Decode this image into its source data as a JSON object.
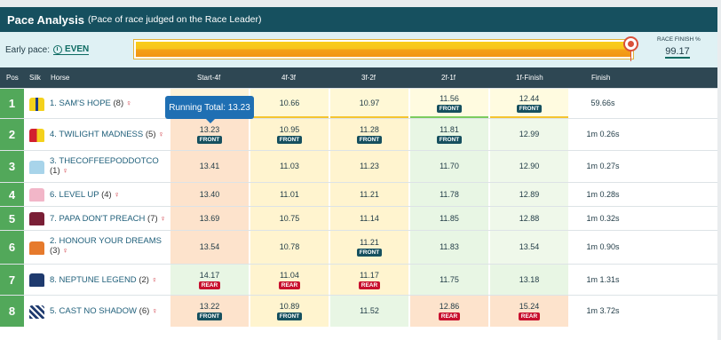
{
  "header": {
    "title": "Pace Analysis",
    "subtitle": "(Pace of race judged on the Race Leader)"
  },
  "pace": {
    "label": "Early pace:",
    "value": "EVEN",
    "finish_label": "RACE FINISH %",
    "finish_value": "99.17",
    "progress": 0.99
  },
  "columns": {
    "pos": "Pos",
    "silk": "Silk",
    "horse": "Horse",
    "c1": "Start-4f",
    "c2": "4f-3f",
    "c3": "3f-2f",
    "c4": "2f-1f",
    "c5": "1f-Finish",
    "finish": "Finish"
  },
  "tooltip": "Running Total: 13.23",
  "colors": {
    "accent": "#16505f",
    "position": "#52a85a",
    "front_badge": "#16505f",
    "rear_badge": "#c8102e",
    "pin": "#cc2b36"
  },
  "rows": [
    {
      "pos": "1",
      "horse": "1. SAM'S HOPE",
      "draw": "(8)",
      "silk": "silk-yellow-blue",
      "cells": [
        {
          "v": ""
        },
        {
          "v": "10.66"
        },
        {
          "v": "10.97"
        },
        {
          "v": "11.56",
          "b": "FRONT"
        },
        {
          "v": "12.44",
          "b": "FRONT"
        }
      ],
      "finish": "59.66s"
    },
    {
      "pos": "2",
      "horse": "4. TWILIGHT MADNESS",
      "draw": "(5)",
      "silk": "silk-red-yellow",
      "cells": [
        {
          "v": "13.23",
          "b": "FRONT"
        },
        {
          "v": "10.95",
          "b": "FRONT"
        },
        {
          "v": "11.28",
          "b": "FRONT"
        },
        {
          "v": "11.81",
          "b": "FRONT"
        },
        {
          "v": "12.99"
        }
      ],
      "finish": "1m 0.26s"
    },
    {
      "pos": "3",
      "horse": "3. THECOFFEEPODDOTCO",
      "draw": "(1)",
      "silk": "silk-lightblue",
      "cells": [
        {
          "v": "13.41"
        },
        {
          "v": "11.03"
        },
        {
          "v": "11.23"
        },
        {
          "v": "11.70"
        },
        {
          "v": "12.90"
        }
      ],
      "finish": "1m 0.27s"
    },
    {
      "pos": "4",
      "horse": "6. LEVEL UP",
      "draw": "(4)",
      "silk": "silk-pink",
      "cells": [
        {
          "v": "13.40"
        },
        {
          "v": "11.01"
        },
        {
          "v": "11.21"
        },
        {
          "v": "11.78"
        },
        {
          "v": "12.89"
        }
      ],
      "finish": "1m 0.28s"
    },
    {
      "pos": "5",
      "horse": "7. PAPA DON'T PREACH",
      "draw": "(7)",
      "silk": "silk-maroon",
      "cells": [
        {
          "v": "13.69"
        },
        {
          "v": "10.75"
        },
        {
          "v": "11.14"
        },
        {
          "v": "11.85"
        },
        {
          "v": "12.88"
        }
      ],
      "finish": "1m 0.32s"
    },
    {
      "pos": "6",
      "horse": "2. HONOUR YOUR DREAMS",
      "draw": "(3)",
      "silk": "silk-orange",
      "cells": [
        {
          "v": "13.54"
        },
        {
          "v": "10.78"
        },
        {
          "v": "11.21",
          "b": "FRONT"
        },
        {
          "v": "11.83"
        },
        {
          "v": "13.54"
        }
      ],
      "finish": "1m 0.90s"
    },
    {
      "pos": "7",
      "horse": "8. NEPTUNE LEGEND",
      "draw": "(2)",
      "silk": "silk-navy",
      "cells": [
        {
          "v": "14.17",
          "b": "REAR"
        },
        {
          "v": "11.04",
          "b": "REAR"
        },
        {
          "v": "11.17",
          "b": "REAR"
        },
        {
          "v": "11.75"
        },
        {
          "v": "13.18"
        }
      ],
      "finish": "1m 1.31s"
    },
    {
      "pos": "8",
      "horse": "5. CAST NO SHADOW",
      "draw": "(6)",
      "silk": "silk-blue-white",
      "cells": [
        {
          "v": "13.22",
          "b": "FRONT"
        },
        {
          "v": "10.89",
          "b": "FRONT"
        },
        {
          "v": "11.52"
        },
        {
          "v": "12.86",
          "b": "REAR"
        },
        {
          "v": "15.24",
          "b": "REAR"
        }
      ],
      "finish": "1m 3.72s"
    }
  ]
}
